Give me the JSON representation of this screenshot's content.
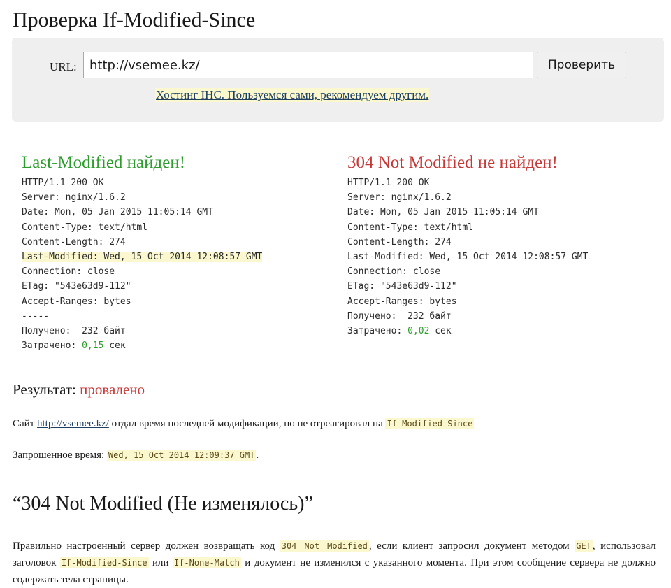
{
  "page": {
    "title": "Проверка If-Modified-Since"
  },
  "form": {
    "url_label": "URL:",
    "url_value": "http://vsemee.kz/",
    "submit_label": "Проверить",
    "promo_link": "Хостинг IHC. Пользуемся сами, рекомендуем другим."
  },
  "left_panel": {
    "heading": "Last-Modified найден!",
    "lines": [
      "HTTP/1.1 200 OK",
      "Server: nginx/1.6.2",
      "Date: Mon, 05 Jan 2015 11:05:14 GMT",
      "Content-Type: text/html",
      "Content-Length: 274",
      "Last-Modified: Wed, 15 Oct 2014 12:08:57 GMT",
      "Connection: close",
      "ETag: \"543e63d9-112\"",
      "Accept-Ranges: bytes",
      "-----",
      "Получено:  232 байт"
    ],
    "time_label": "Затрачено: ",
    "time_value": "0,15",
    "time_unit": " сек"
  },
  "right_panel": {
    "heading": "304 Not Modified не найден!",
    "lines": [
      "HTTP/1.1 200 OK",
      "Server: nginx/1.6.2",
      "Date: Mon, 05 Jan 2015 11:05:14 GMT",
      "Content-Type: text/html",
      "Content-Length: 274",
      "Last-Modified: Wed, 15 Oct 2014 12:08:57 GMT",
      "Connection: close",
      "ETag: \"543e63d9-112\"",
      "Accept-Ranges: bytes",
      "Получено:  232 байт"
    ],
    "time_label": "Затрачено: ",
    "time_value": "0,02",
    "time_unit": " сек"
  },
  "result": {
    "label": "Результат: ",
    "value": "провалено",
    "p1_prefix": "Сайт ",
    "p1_link": "http://vsemee.kz/",
    "p1_middle": " отдал время последней модификации, но не отреагировал на ",
    "p1_code": "If-Modified-Since",
    "p2_prefix": "Запрошенное время: ",
    "p2_code": "Wed, 15 Oct 2014 12:09:37 GMT",
    "p2_suffix": "."
  },
  "section": {
    "heading": "“304 Not Modified (Не изменялось)”",
    "t1": "Правильно настроенный сервер должен возвращать код ",
    "c1": "304 Not Modified",
    "t2": ", если клиент запросил документ методом ",
    "c2": "GET",
    "t3": ", использовал заголовок ",
    "c3": "If-Modified-Since",
    "t4": " или ",
    "c4": "If-None-Match",
    "t5": " и документ не изменился с указанного момента. При этом сообщение сервера не должно содержать тела страницы."
  },
  "colors": {
    "success": "#2e9b2e",
    "failure": "#c73838",
    "highlight": "#fbf8cf",
    "link": "#1f3f63"
  }
}
